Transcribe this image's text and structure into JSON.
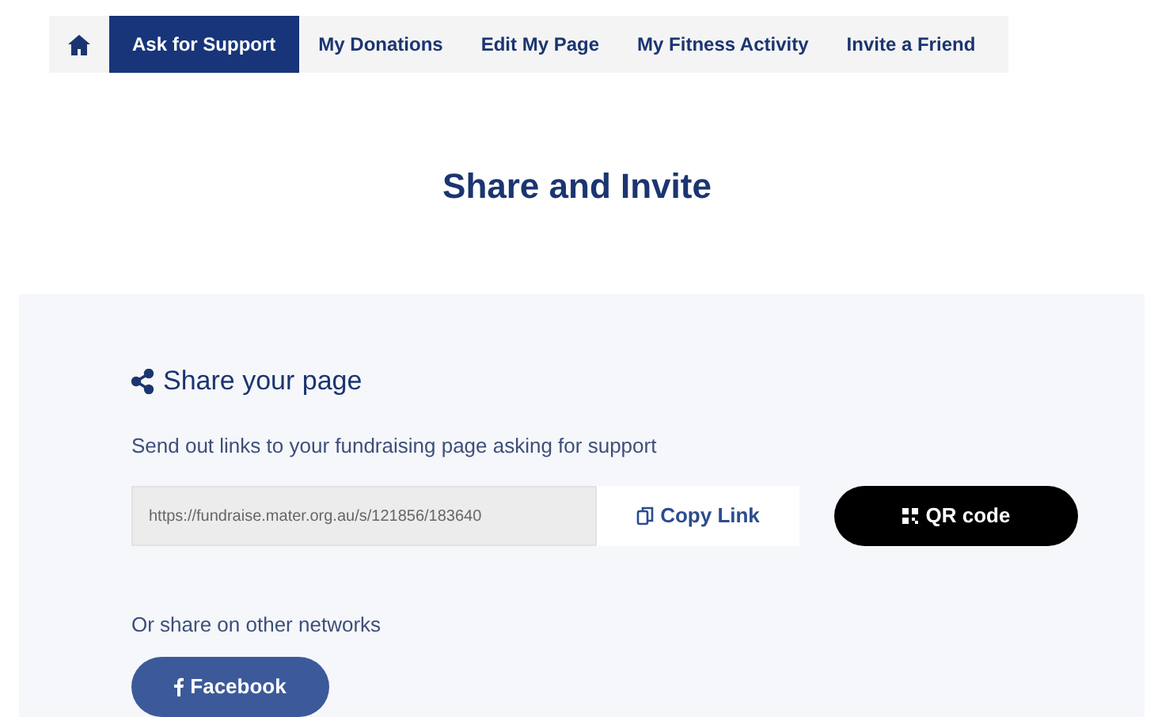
{
  "tabs": [
    {
      "kind": "home",
      "selected": false
    },
    {
      "kind": "text",
      "label": "Ask for Support",
      "selected": true
    },
    {
      "kind": "text",
      "label": "My Donations",
      "selected": false
    },
    {
      "kind": "text",
      "label": "Edit My Page",
      "selected": false
    },
    {
      "kind": "text",
      "label": "My Fitness Activity",
      "selected": false
    },
    {
      "kind": "text",
      "label": "Invite a Friend",
      "selected": false
    }
  ],
  "heading": "Share and Invite",
  "share": {
    "title": "Share your page",
    "description": "Send out links to your fundraising page asking for support",
    "link": {
      "value": "https://fundraise.mater.org.au/s/121856/183640"
    },
    "copy_button": "Copy Link",
    "qr_button": "QR code",
    "networks_label": "Or share on other networks",
    "networks": [
      "Facebook"
    ]
  }
}
